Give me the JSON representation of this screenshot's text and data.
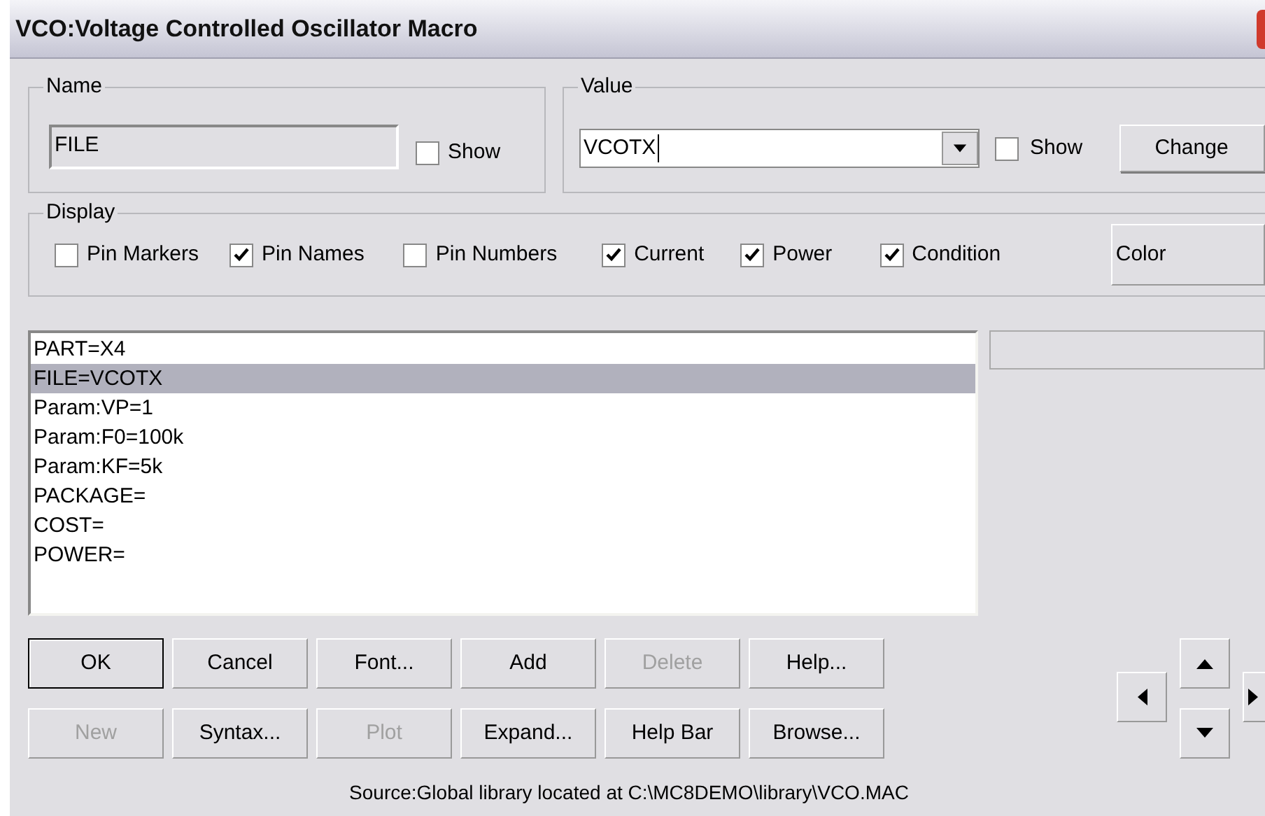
{
  "window": {
    "title": "VCO:Voltage Controlled Oscillator Macro"
  },
  "name_group": {
    "label": "Name",
    "value": "FILE",
    "show": {
      "label": "Show",
      "checked": false
    }
  },
  "value_group": {
    "label": "Value",
    "value": "VCOTX",
    "show": {
      "label": "Show",
      "checked": false
    },
    "change_button": "Change"
  },
  "display_group": {
    "label": "Display",
    "options": [
      {
        "label": "Pin Markers",
        "checked": false
      },
      {
        "label": "Pin Names",
        "checked": true
      },
      {
        "label": "Pin Numbers",
        "checked": false
      },
      {
        "label": "Current",
        "checked": true
      },
      {
        "label": "Power",
        "checked": true
      },
      {
        "label": "Condition",
        "checked": true
      }
    ],
    "color_button": "Color"
  },
  "attributes": [
    {
      "text": "PART=X4",
      "selected": false
    },
    {
      "text": "FILE=VCOTX",
      "selected": true
    },
    {
      "text": "Param:VP=1",
      "selected": false
    },
    {
      "text": "Param:F0=100k",
      "selected": false
    },
    {
      "text": "Param:KF=5k",
      "selected": false
    },
    {
      "text": "PACKAGE=",
      "selected": false
    },
    {
      "text": "COST=",
      "selected": false
    },
    {
      "text": "POWER=",
      "selected": false
    }
  ],
  "buttons_row_1": [
    {
      "label": "OK",
      "disabled": false,
      "default": true
    },
    {
      "label": "Cancel",
      "disabled": false,
      "default": false
    },
    {
      "label": "Font...",
      "disabled": false,
      "default": false
    },
    {
      "label": "Add",
      "disabled": false,
      "default": false
    },
    {
      "label": "Delete",
      "disabled": true,
      "default": false
    },
    {
      "label": "Help...",
      "disabled": false,
      "default": false
    }
  ],
  "buttons_row_2": [
    {
      "label": "New",
      "disabled": true,
      "default": false
    },
    {
      "label": "Syntax...",
      "disabled": false,
      "default": false
    },
    {
      "label": "Plot",
      "disabled": true,
      "default": false
    },
    {
      "label": "Expand...",
      "disabled": false,
      "default": false
    },
    {
      "label": "Help Bar",
      "disabled": false,
      "default": false
    },
    {
      "label": "Browse...",
      "disabled": false,
      "default": false
    }
  ],
  "status": "Source:Global library located at C:\\MC8DEMO\\library\\VCO.MAC"
}
